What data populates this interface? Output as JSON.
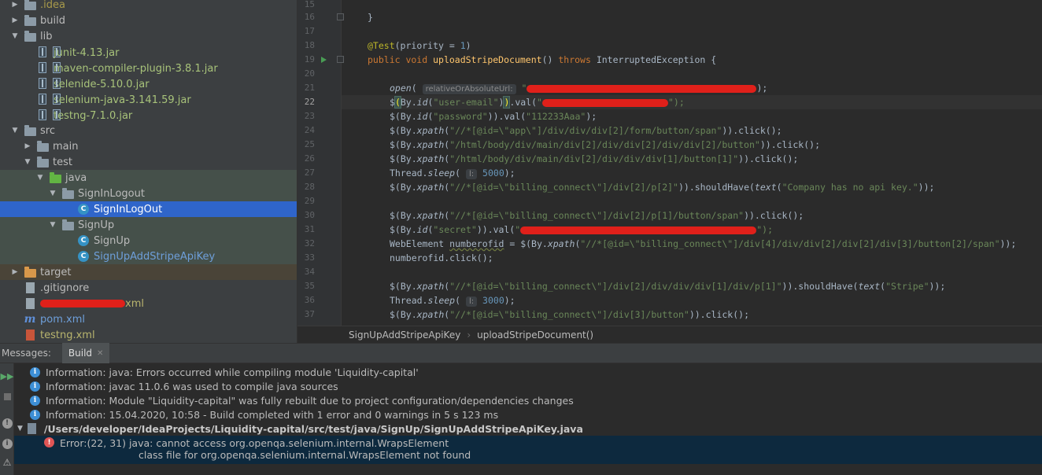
{
  "project_tree": {
    "items": [
      {
        "label": ".idea",
        "icon": "folder-icon"
      },
      {
        "label": "build",
        "icon": "folder-icon"
      },
      {
        "label": "lib",
        "icon": "folder-icon"
      },
      {
        "label": "junit-4.13.jar",
        "icon": "jar-icon"
      },
      {
        "label": "maven-compiler-plugin-3.8.1.jar",
        "icon": "jar-icon"
      },
      {
        "label": "selenide-5.10.0.jar",
        "icon": "jar-icon"
      },
      {
        "label": "selenium-java-3.141.59.jar",
        "icon": "jar-icon"
      },
      {
        "label": "testng-7.1.0.jar",
        "icon": "jar-icon"
      },
      {
        "label": "src",
        "icon": "folder-icon"
      },
      {
        "label": "main",
        "icon": "folder-icon"
      },
      {
        "label": "test",
        "icon": "folder-icon"
      },
      {
        "label": "java",
        "icon": "test-folder-icon"
      },
      {
        "label": "SignInLogout",
        "icon": "package-icon"
      },
      {
        "label": "SignInLogOut",
        "icon": "class-icon"
      },
      {
        "label": "SignUp",
        "icon": "package-icon"
      },
      {
        "label": "SignUp",
        "icon": "class-icon"
      },
      {
        "label": "SignUpAddStripeApiKey",
        "icon": "class-icon"
      },
      {
        "label": "target",
        "icon": "folder-icon"
      },
      {
        "label": ".gitignore",
        "icon": "gitignore-icon"
      },
      {
        "label": "xml",
        "icon": "xml-file-icon"
      },
      {
        "label": "pom.xml",
        "icon": "maven-icon"
      },
      {
        "label": "testng.xml",
        "icon": "xml-file-icon"
      }
    ]
  },
  "editor": {
    "line_numbers": [
      "15",
      "16",
      "17",
      "18",
      "19",
      "20",
      "21",
      "22",
      "23",
      "24",
      "25",
      "26",
      "27",
      "28",
      "29",
      "30",
      "31",
      "32",
      "33",
      "34",
      "35",
      "36",
      "37"
    ],
    "current_line": "22",
    "hints": {
      "open": "relativeOrAbsoluteUrl:",
      "sleep1": "l:",
      "sleep2": "l:"
    },
    "code": {
      "l16": "}",
      "l18_ann": "@Test",
      "l18_rest": "(priority = ",
      "l18_num": "1",
      "l18_end": ")",
      "l19_kw1": "public void ",
      "l19_fn": "uploadStripeDocument",
      "l19_mid": "() ",
      "l19_kw2": "throws ",
      "l19_end": "InterruptedException {",
      "l21_open": "open",
      "l21_paren": "(",
      "l21_q": "\"",
      "l21_end": ");",
      "l22_a": "$",
      "l22_b": "(",
      "l22_c": "By.",
      "l22_d": "id",
      "l22_e": "(",
      "l22_f": "\"user-email\"",
      "l22_g": ")",
      "l22_h": ")",
      "l22_i": ".val(",
      "l22_j": "\"",
      "l22_k": "\");",
      "l23_pre": "$(By.",
      "l23_id": "id",
      "l23_mid": "(",
      "l23_s1": "\"password\"",
      "l23_mid2": ")).val(",
      "l23_s2": "\"112233Aaa\"",
      "l23_end": ");",
      "l24_pre": "$(By.",
      "l24_x": "xpath",
      "l24_s": "\"//*[@id=\\\"app\\\"]/div/div/div[2]/form/button/span\"",
      "l24_end": ")).click();",
      "l25_s": "\"/html/body/div/main/div[2]/div/div[2]/div/div[2]/button\"",
      "l26_s": "\"/html/body/div/main/div[2]/div/div/div[1]/button[1]\"",
      "l27_pre": "Thread.",
      "l27_fn": "sleep",
      "l27_num": "5000",
      "l27_end": ");",
      "l28_s": "\"//*[@id=\\\"billing_connect\\\"]/div[2]/p[2]\"",
      "l28_mid": ")).shouldHave(",
      "l28_text": "text",
      "l28_s2": "\"Company has no api key.\"",
      "l28_end": "));",
      "l30_s": "\"//*[@id=\\\"billing_connect\\\"]/div[2]/p[1]/button/span\"",
      "l31_s1": "\"secret\"",
      "l31_end": "\");",
      "l32_pre": "WebElement ",
      "l32_var": "numberofid",
      "l32_mid": " = $(By.",
      "l32_s": "\"//*[@id=\\\"billing_connect\\\"]/div[4]/div/div[2]/div[2]/div[3]/button[2]/span\"",
      "l32_end": "));",
      "l33": "numberofid.click();",
      "l35_s": "\"//*[@id=\\\"billing_connect\\\"]/div[2]/div/div/div[1]/div/p[1]\"",
      "l35_s2": "\"Stripe\"",
      "l36_num": "3000",
      "l37_s": "\"//*[@id=\\\"billing_connect\\\"]/div[3]/button\""
    }
  },
  "breadcrumb": {
    "class_name": "SignUpAddStripeApiKey",
    "method_name": "uploadStripeDocument()"
  },
  "messages": {
    "title": "Messages:",
    "tab_label": "Build",
    "lines": [
      "Information: java: Errors occurred while compiling module 'Liquidity-capital'",
      "Information: javac 11.0.6 was used to compile java sources",
      "Information: Module \"Liquidity-capital\" was fully rebuilt due to project configuration/dependencies changes",
      "Information: 15.04.2020, 10:58 - Build completed with 1 error and 0 warnings in 5 s 123 ms"
    ],
    "file_path": "/Users/developer/IdeaProjects/Liquidity-capital/src/test/java/SignUp/SignUpAddStripeApiKey.java",
    "error_line1": "Error:(22, 31)  java: cannot access org.openqa.selenium.internal.WrapsElement",
    "error_line2": "class file for org.openqa.selenium.internal.WrapsElement not found"
  },
  "colors": {
    "selection": "#2f65ca",
    "error": "#e05555",
    "info": "#3d8fd6"
  }
}
